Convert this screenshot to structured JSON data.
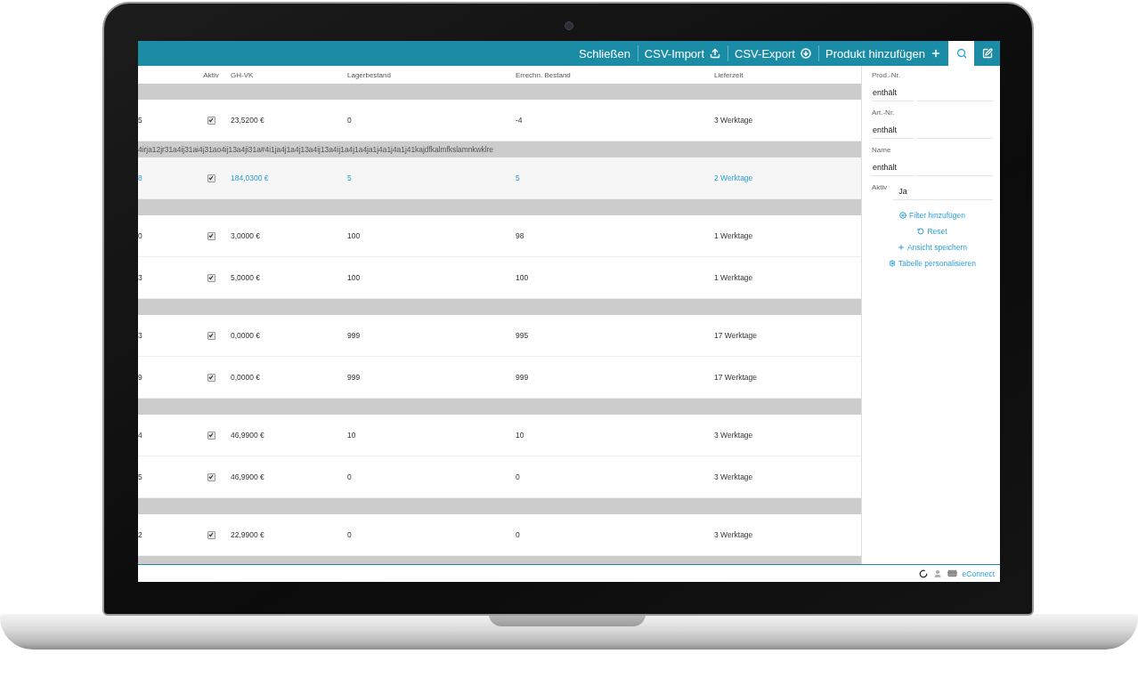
{
  "toolbar": {
    "buttons": [
      {
        "label": "Schließen"
      },
      {
        "label": "CSV-Import"
      },
      {
        "label": "CSV-Export"
      },
      {
        "label": "Produkt hinzufügen"
      }
    ],
    "tool_buttons": [
      {
        "selected": true
      },
      {
        "selected": false
      }
    ]
  },
  "table": {
    "columns": [
      "Aktiv",
      "GH-VK",
      "Lagerbestand",
      "Errechn. Bestand",
      "Lieferzeit"
    ],
    "rows": [
      {
        "kind": "group"
      },
      {
        "kind": "item",
        "selected": false,
        "column_1": "5",
        "active": true,
        "price": "23,5200 €",
        "stock": "0",
        "computed": "-4",
        "delivery": "3 Werktage"
      },
      {
        "kind": "group",
        "label": "4irja12jr31a4ij31ai4j31ao4ij13a4ji31a#4i1ja4j1a4j13a4ij13a4ij1a4j1a4ja1j4a1j4a1j41kajdfkalmfkslamnkwklre"
      },
      {
        "kind": "item",
        "selected": true,
        "column_1": "8",
        "active": true,
        "price": "184,0300 €",
        "stock": "5",
        "computed": "5",
        "delivery": "2 Werktage"
      },
      {
        "kind": "group"
      },
      {
        "kind": "item",
        "selected": false,
        "column_1": "0",
        "active": true,
        "price": "3,0000 €",
        "stock": "100",
        "computed": "98",
        "delivery": "1 Werktage"
      },
      {
        "kind": "item",
        "selected": false,
        "column_1": "3",
        "active": true,
        "price": "5,0000 €",
        "stock": "100",
        "computed": "100",
        "delivery": "1 Werktage"
      },
      {
        "kind": "group"
      },
      {
        "kind": "item",
        "selected": false,
        "column_1": "3",
        "active": true,
        "price": "0,0000 €",
        "stock": "999",
        "computed": "995",
        "delivery": "17 Werktage"
      },
      {
        "kind": "item",
        "selected": false,
        "column_1": "9",
        "active": true,
        "price": "0,0000 €",
        "stock": "999",
        "computed": "999",
        "delivery": "17 Werktage"
      },
      {
        "kind": "group"
      },
      {
        "kind": "item",
        "selected": false,
        "column_1": "4",
        "active": true,
        "price": "46,9900 €",
        "stock": "10",
        "computed": "10",
        "delivery": "3 Werktage"
      },
      {
        "kind": "item",
        "selected": false,
        "column_1": "5",
        "active": true,
        "price": "46,9900 €",
        "stock": "0",
        "computed": "0",
        "delivery": "3 Werktage"
      },
      {
        "kind": "group"
      },
      {
        "kind": "item",
        "selected": false,
        "column_1": "2",
        "active": true,
        "price": "22,9900 €",
        "stock": "0",
        "computed": "0",
        "delivery": "3 Werktage"
      },
      {
        "kind": "group"
      }
    ]
  },
  "filters": {
    "fields": [
      {
        "kind": "stacked",
        "label": "Prod.-Nr.",
        "operator": "enthält"
      },
      {
        "kind": "stacked",
        "label": "Art.-Nr.",
        "operator": "enthält"
      },
      {
        "kind": "stacked",
        "label": "Name",
        "operator": "enthält"
      },
      {
        "kind": "inline",
        "label": "Aktiv",
        "value": "Ja"
      }
    ],
    "links": [
      {
        "label": "Filter hinzufügen"
      },
      {
        "label": "Reset"
      },
      {
        "label": "Ansicht speichern"
      },
      {
        "label": "Tabelle personalisieren"
      }
    ]
  },
  "status_bar": {
    "link": "eConnect"
  }
}
